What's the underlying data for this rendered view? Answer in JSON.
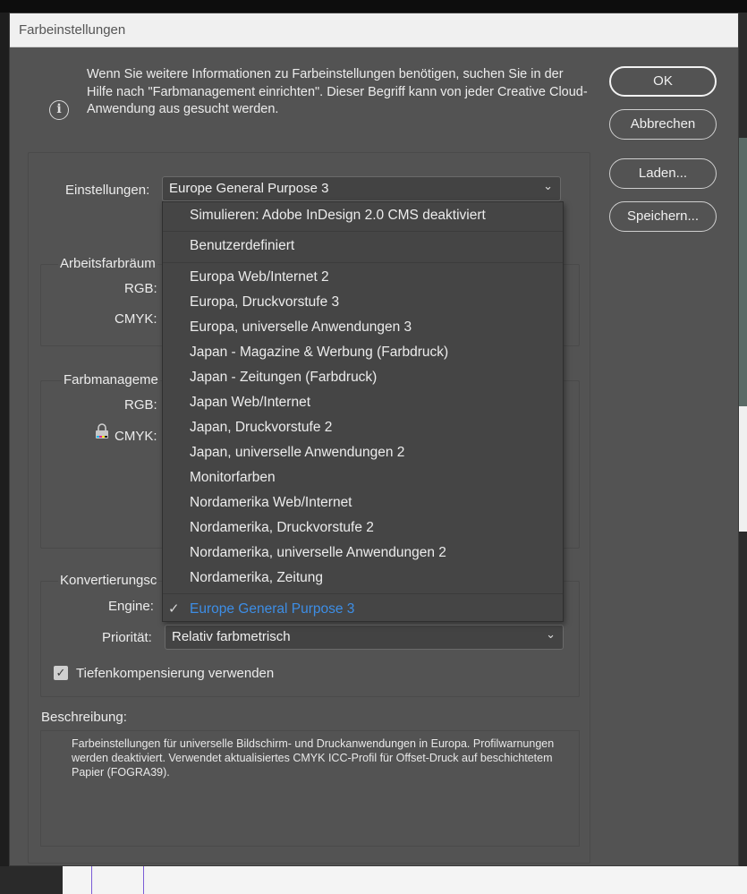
{
  "dialog": {
    "title": "Farbeinstellungen",
    "info_text": "Wenn Sie weitere Informationen zu Farbeinstellungen benötigen, suchen Sie in der Hilfe nach \"Farbmanagement einrichten\". Dieser Begriff kann von jeder Creative Cloud-Anwendung aus gesucht werden.",
    "buttons": {
      "ok": "OK",
      "cancel": "Abbrechen",
      "load": "Laden...",
      "save": "Speichern..."
    }
  },
  "settings": {
    "label": "Einstellungen:",
    "value": "Europe General Purpose 3"
  },
  "working_spaces": {
    "title": "Arbeitsfarbräum",
    "rgb_label": "RGB:",
    "cmyk_label": "CMYK:"
  },
  "color_management": {
    "title": "Farbmanageme",
    "rgb_label": "RGB:",
    "cmyk_label": "CMYK:"
  },
  "conversion": {
    "title": "Konvertierungsc",
    "engine_label": "Engine:",
    "priority_label": "Priorität:",
    "priority_value": "Relativ farbmetrisch",
    "black_point_label": "Tiefenkompensierung verwenden",
    "black_point_checked": true
  },
  "description": {
    "label": "Beschreibung:",
    "text": "Farbeinstellungen für universelle Bildschirm- und Druckanwendungen in Europa. Profilwarnungen werden deaktiviert. Verwendet aktualisiertes CMYK ICC-Profil für Offset-Druck auf beschichtetem Papier (FOGRA39)."
  },
  "dropdown": {
    "items": [
      "Simulieren: Adobe InDesign 2.0 CMS deaktiviert",
      "Benutzerdefiniert",
      "Europa Web/Internet 2",
      "Europa, Druckvorstufe 3",
      "Europa, universelle Anwendungen 3",
      "Japan - Magazine & Werbung (Farbdruck)",
      "Japan - Zeitungen (Farbdruck)",
      "Japan Web/Internet",
      "Japan, Druckvorstufe 2",
      "Japan, universelle Anwendungen 2",
      "Monitorfarben",
      "Nordamerika Web/Internet",
      "Nordamerika, Druckvorstufe 2",
      "Nordamerika, universelle Anwendungen 2",
      "Nordamerika, Zeitung",
      "Europe General Purpose 3"
    ],
    "selected_index": 15,
    "check_glyph": "✓",
    "selected_color": "#3d8ee6"
  }
}
